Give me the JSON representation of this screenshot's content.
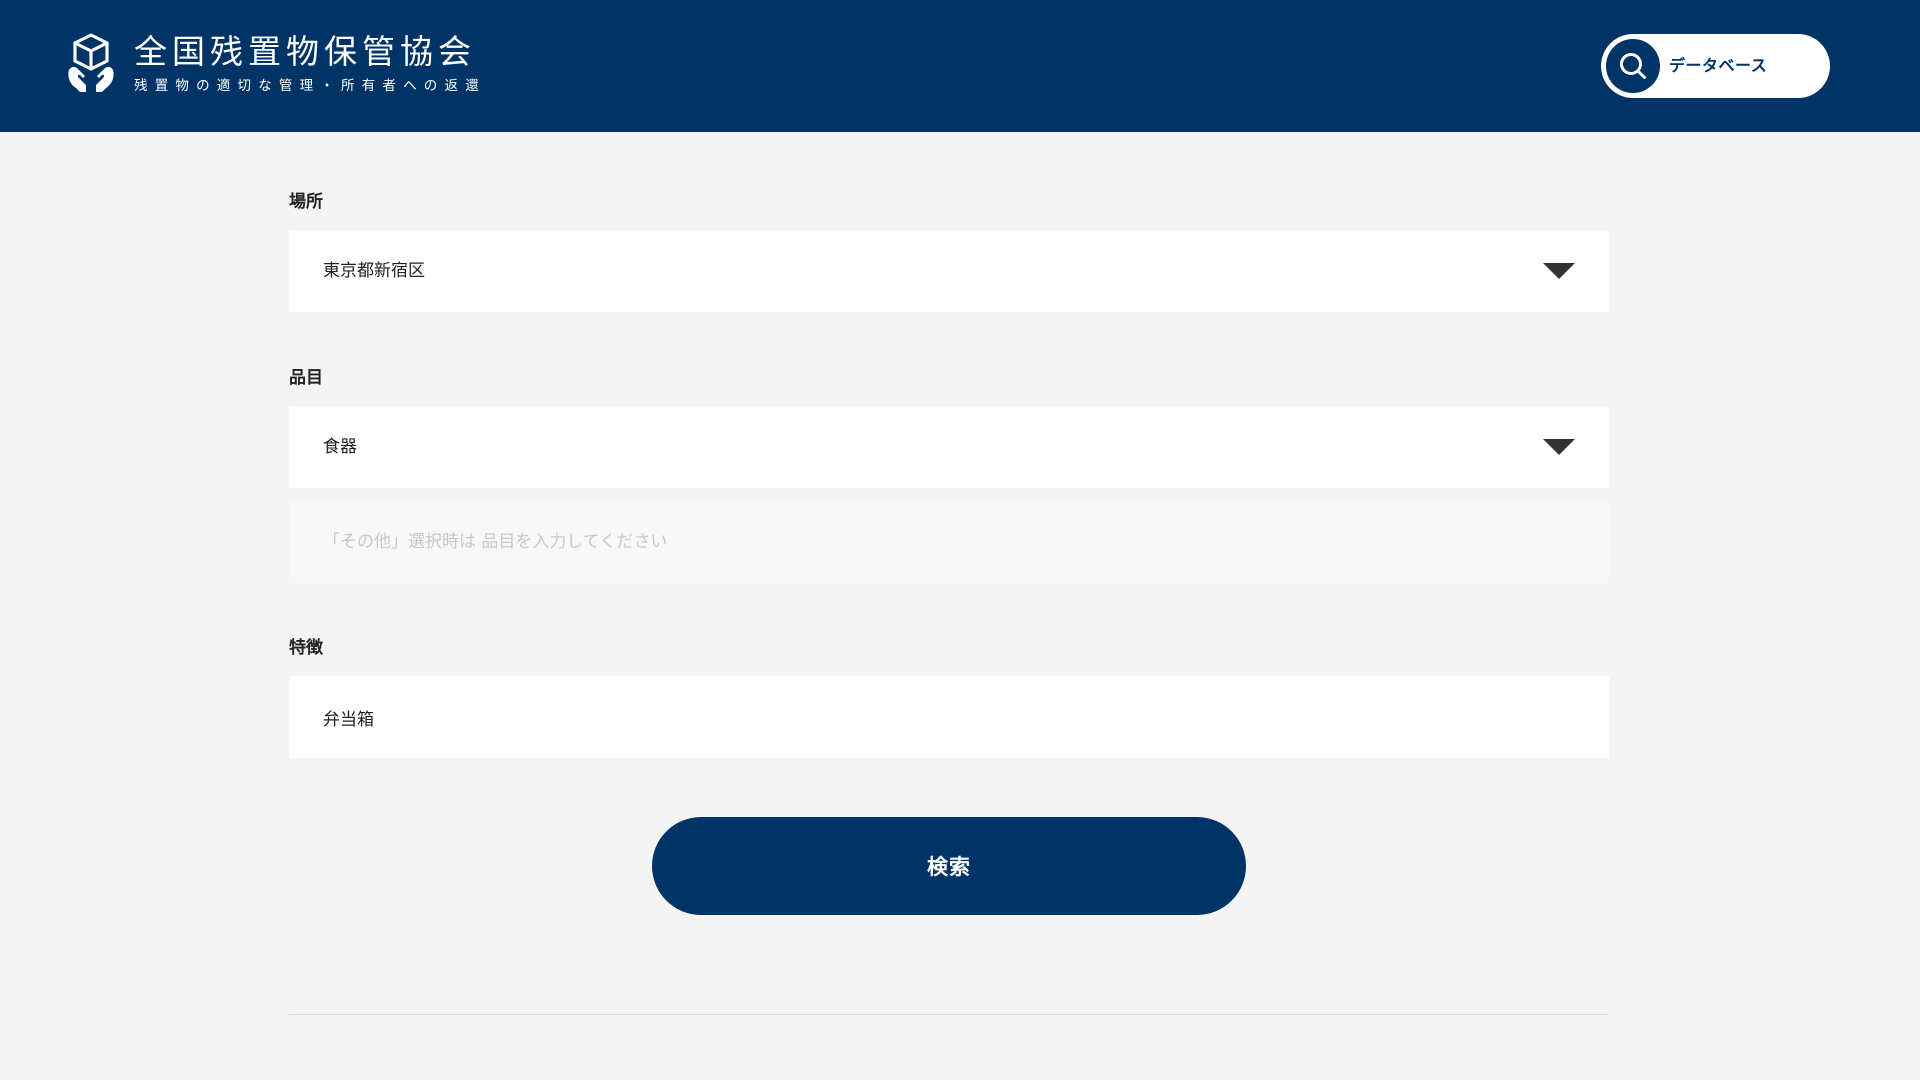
{
  "header": {
    "org_name": "全国残置物保管協会",
    "tagline": "残置物の適切な管理・所有者への返還",
    "database_button_label": "データベース"
  },
  "form": {
    "location": {
      "label": "場所",
      "selected": "東京都新宿区"
    },
    "item": {
      "label": "品目",
      "selected": "食器",
      "other_placeholder": "「その他」選択時は 品目を入力してください",
      "other_value": ""
    },
    "feature": {
      "label": "特徴",
      "value": "弁当箱"
    },
    "search_button_label": "検索"
  },
  "colors": {
    "brand_navy": "#003366",
    "page_background": "#f4f4f4",
    "field_background": "#ffffff"
  },
  "icons": [
    "box-hands-logo-icon",
    "search-icon",
    "chevron-down-icon"
  ]
}
